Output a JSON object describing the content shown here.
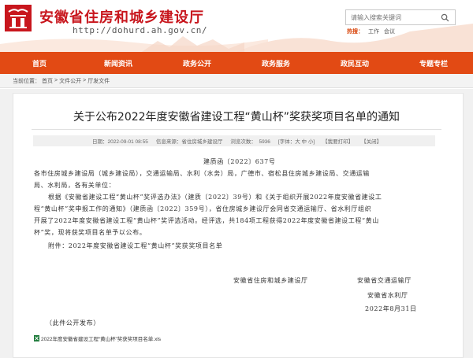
{
  "header": {
    "site_title": "安徽省住房和城乡建设厅",
    "site_url": "http://dohurd.ah.gov.cn/",
    "search_placeholder": "请输入搜索关键词",
    "hot_label": "热搜：",
    "hot_items": [
      "工作",
      "会议"
    ]
  },
  "nav": {
    "items": [
      "首页",
      "新闻资讯",
      "政务公开",
      "政务服务",
      "政民互动",
      "专题专栏"
    ]
  },
  "breadcrumb": {
    "prefix": "当前位置：",
    "items": [
      "首页",
      "文件公开",
      "厅发文件"
    ],
    "separator": ">"
  },
  "article": {
    "title": "关于公布2022年度安徽省建设工程“黄山杯”奖获奖项目名单的通知",
    "date": "日期：2022-09-01 08:55",
    "source": "信息来源：省住房城乡建设厅",
    "views": "浏览次数：",
    "views_count": "5936",
    "font_size": "字体：",
    "font_large": "大",
    "font_medium": "中",
    "font_small": "小",
    "print": "【我要打印】",
    "close": "【关闭】",
    "doc_no": "建质函〔2022〕637号",
    "recipients_1": "各市住房城乡建设局（城乡建设局），交通运输局、水利（水务）局，广德市、宿松县住房城乡建设局、交通运输",
    "recipients_2": "局、水利局，各有关单位：",
    "p1_1": "根据《安徽省建设工程“黄山杯”奖评选办法》（建质〔2022〕39号）和《关于组织开展2022年度安徽省建设工",
    "p1_2": "程“黄山杯”奖申报工作的通知》（建质函〔2022〕359号），省住房城乡建设厅会同省交通运输厅、省水利厅组织",
    "p1_3": "开展了2022年度安徽省建设工程“黄山杯”奖评选活动。经评选，共184项工程获得2022年度安徽省建设工程“黄山",
    "p1_4": "杯”奖，现将获奖项目名单予以公布。",
    "attachment_line": "附件：2022年度安徽省建设工程“黄山杯”奖获奖项目名单",
    "sign_1": "安徽省住房和城乡建设厅",
    "sign_2": "安徽省交通运输厅",
    "sign_3": "安徽省水利厅",
    "sign_date": "2022年8月31日",
    "public_note": "（此件公开发布）",
    "attachment_file": "2022年度安徽省建设工程“黄山杯”奖获奖项目名单.xls"
  },
  "colors": {
    "brand_red": "#c8161d",
    "nav_orange": "#e24a14"
  }
}
